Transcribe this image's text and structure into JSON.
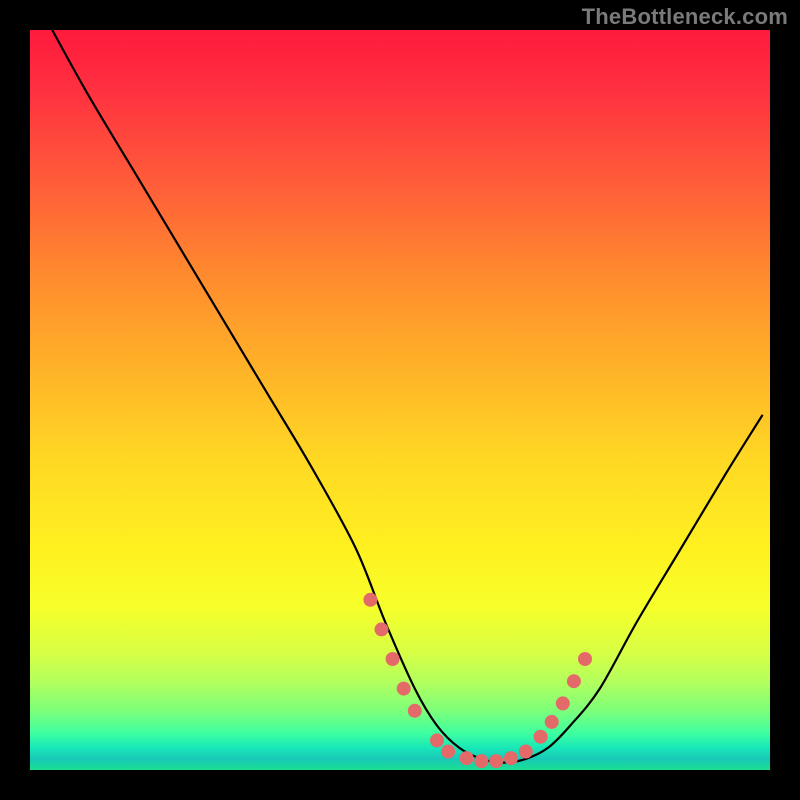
{
  "watermark": "TheBottleneck.com",
  "chart_data": {
    "type": "line",
    "title": "",
    "xlabel": "",
    "ylabel": "",
    "xlim": [
      0,
      100
    ],
    "ylim": [
      0,
      100
    ],
    "series": [
      {
        "name": "curve",
        "x": [
          3,
          8,
          14,
          20,
          26,
          32,
          38,
          44,
          48,
          52,
          55,
          58,
          61,
          64,
          67,
          70,
          73,
          77,
          82,
          88,
          94,
          99
        ],
        "y": [
          100,
          91,
          81,
          71,
          61,
          51,
          41,
          30,
          20,
          11,
          6,
          3,
          1.5,
          1,
          1.5,
          3,
          6,
          11,
          20,
          30,
          40,
          48
        ]
      }
    ],
    "markers": {
      "name": "highlight-dots",
      "color": "#e46a6a",
      "x": [
        46,
        47.5,
        49,
        50.5,
        52,
        55,
        56.5,
        59,
        61,
        63,
        65,
        67,
        69,
        70.5,
        72,
        73.5,
        75
      ],
      "y": [
        23,
        19,
        15,
        11,
        8,
        4,
        2.5,
        1.6,
        1.2,
        1.2,
        1.6,
        2.5,
        4.5,
        6.5,
        9,
        12,
        15
      ]
    }
  }
}
